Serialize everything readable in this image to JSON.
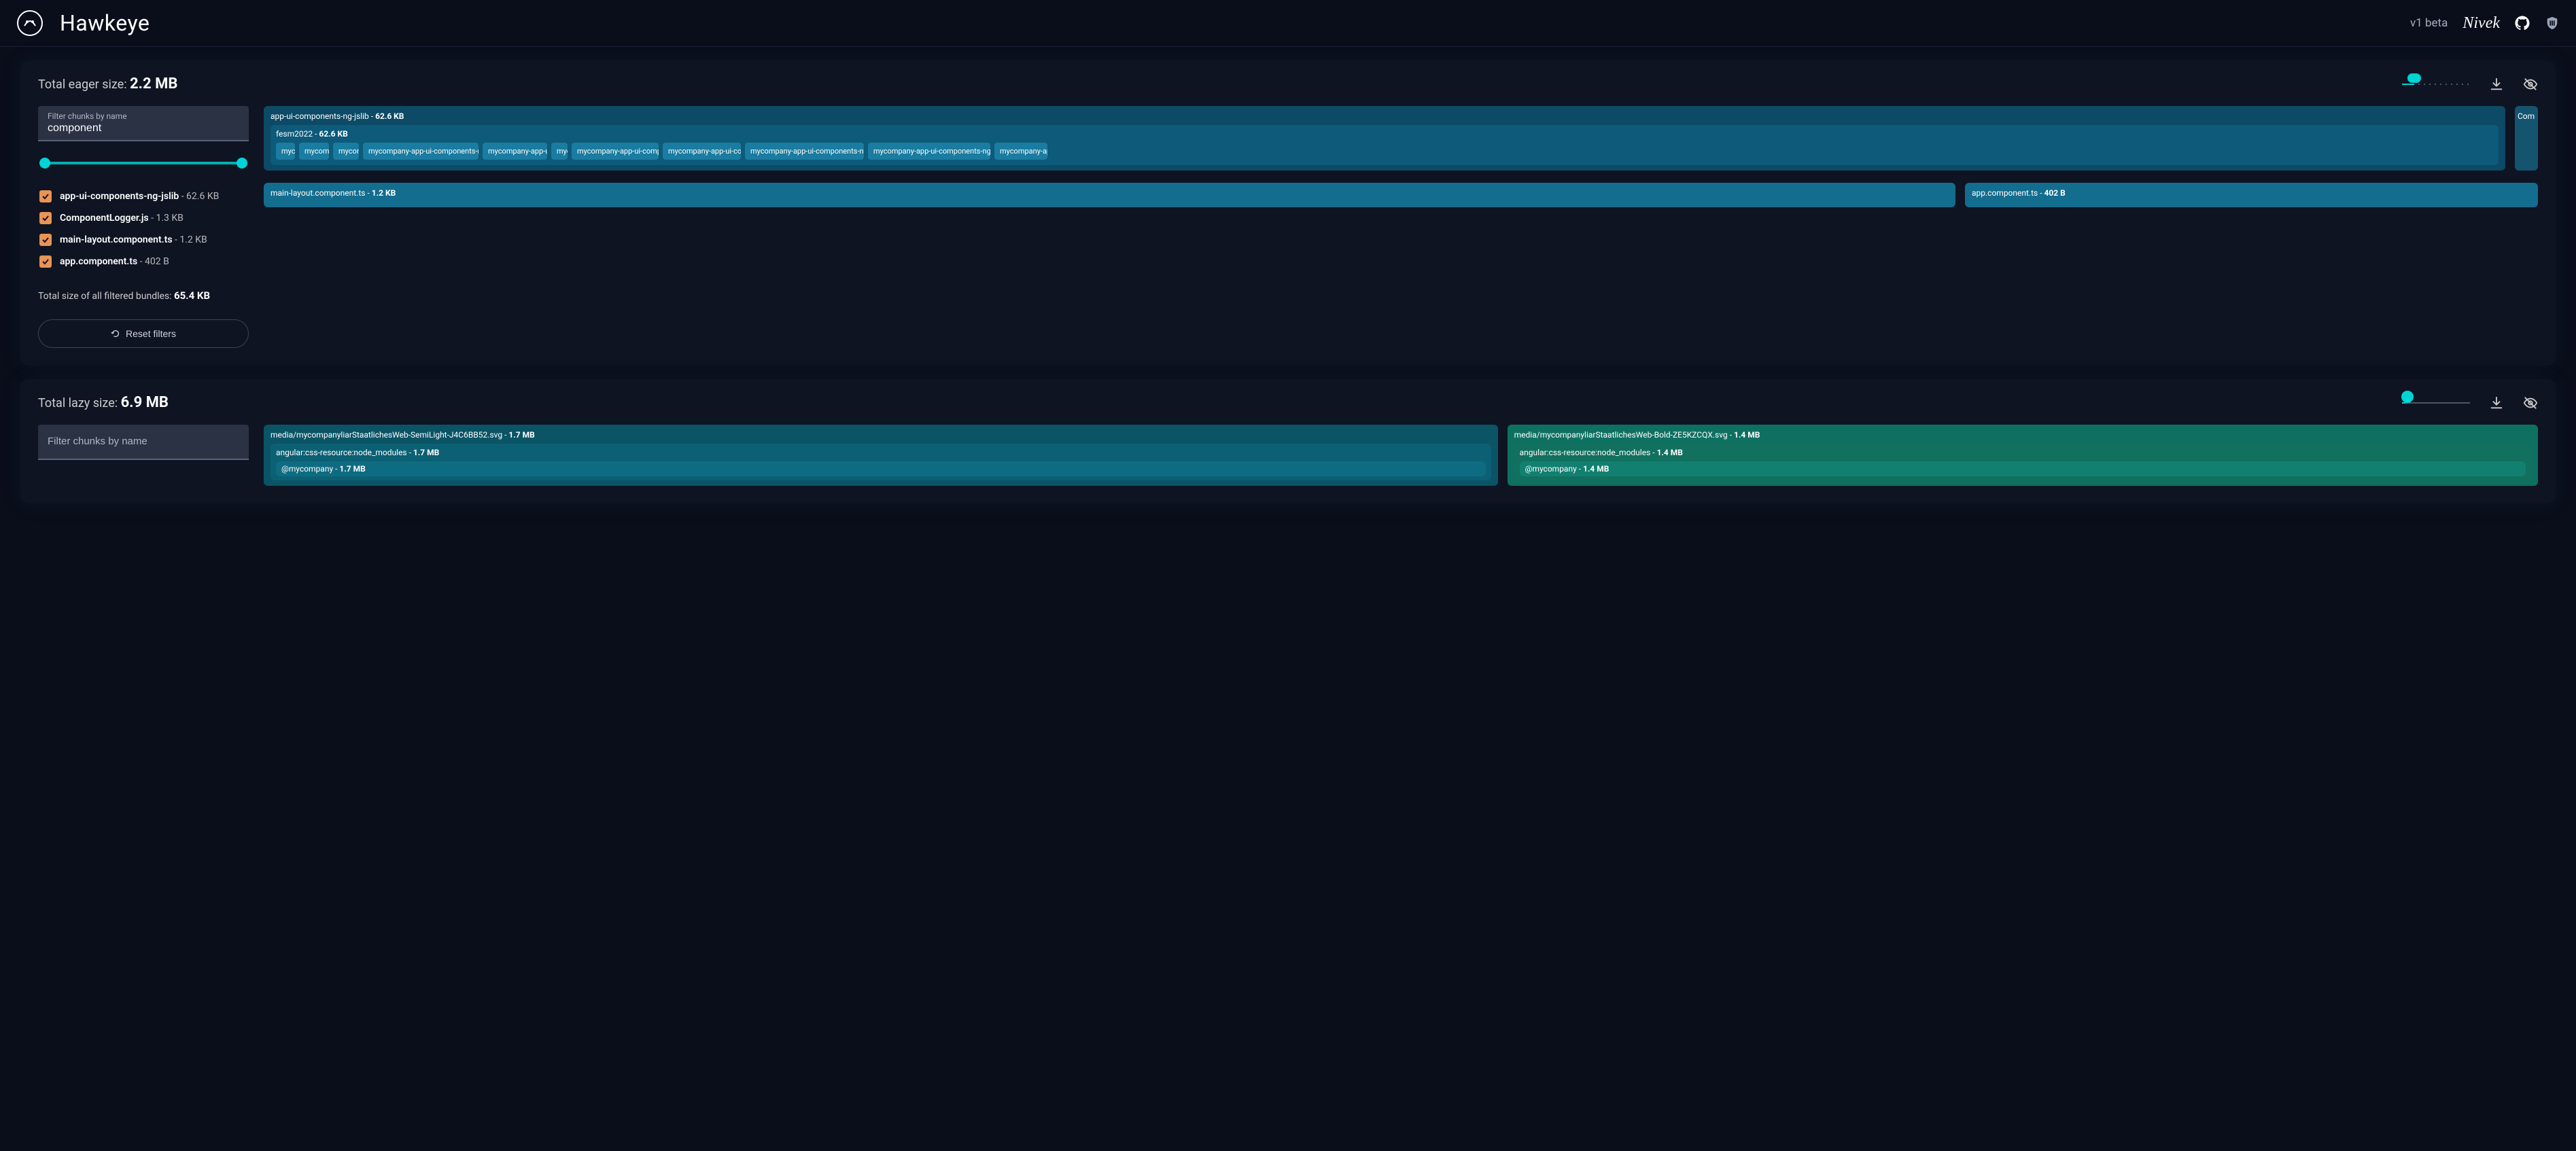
{
  "header": {
    "app_title": "Hawkeye",
    "version": "v1 beta",
    "author": "Nivek"
  },
  "sections": [
    {
      "id": "eager",
      "title_prefix": "Total eager size: ",
      "total_size": "2.2 MB",
      "slider_pos_pct": 18,
      "filter": {
        "label": "Filter chunks by name",
        "value": "component"
      },
      "range": {
        "min_pct": 2,
        "max_pct": 98
      },
      "chunks": [
        {
          "name": "app-ui-components-ng-jslib",
          "size": "62.6 KB"
        },
        {
          "name": "ComponentLogger.js",
          "size": "1.3 KB"
        },
        {
          "name": "main-layout.component.ts",
          "size": "1.2 KB"
        },
        {
          "name": "app.component.ts",
          "size": "402 B"
        }
      ],
      "filtered_total_label": "Total size of all filtered bundles: ",
      "filtered_total": "65.4 KB",
      "reset_label": "Reset filters",
      "treemap": {
        "main_block": {
          "name": "app-ui-components-ng-jslib",
          "size": "62.6 KB",
          "sub": {
            "name": "fesm2022",
            "size": "62.6 KB"
          },
          "chips": [
            "mycom",
            "mycomp",
            "mycomp",
            "mycompany-app-ui-components-ng-jslib",
            "mycompany-app-ui-co",
            "myc",
            "mycompany-app-ui-compone",
            "mycompany-app-ui-comp",
            "mycompany-app-ui-components-ng-jslib-s",
            "mycompany-app-ui-components-ng-jslib-s",
            "mycompany-app"
          ]
        },
        "side_label": "Com",
        "row2_left": {
          "name": "main-layout.component.ts",
          "size": "1.2 KB"
        },
        "row2_right": {
          "name": "app.component.ts",
          "size": "402 B"
        }
      }
    },
    {
      "id": "lazy",
      "title_prefix": "Total lazy size: ",
      "total_size": "6.9 MB",
      "slider_pos_pct": 5,
      "filter": {
        "placeholder": "Filter chunks by name",
        "value": ""
      },
      "treemap": {
        "left": {
          "name": "media/mycompanyliarStaatlichesWeb-SemiLight-J4C6BB52.svg",
          "size": "1.7 MB",
          "sub": {
            "name": "angular:css-resource:node_modules",
            "size": "1.7 MB"
          },
          "sub2": {
            "name": "@mycompany",
            "size": "1.7 MB"
          }
        },
        "right": {
          "name": "media/mycompanyliarStaatlichesWeb-Bold-ZE5KZCQX.svg",
          "size": "1.4 MB",
          "sub": {
            "name": "angular:css-resource:node_modules",
            "size": "1.4 MB"
          },
          "sub2": {
            "name": "@mycompany",
            "size": "1.4 MB"
          }
        }
      }
    }
  ]
}
